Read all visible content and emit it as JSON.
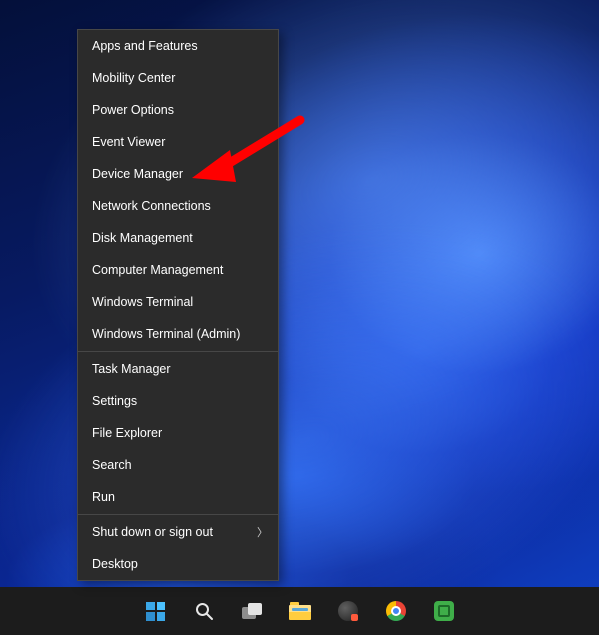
{
  "context_menu": {
    "groups": [
      [
        {
          "label": "Apps and Features",
          "has_submenu": false
        },
        {
          "label": "Mobility Center",
          "has_submenu": false
        },
        {
          "label": "Power Options",
          "has_submenu": false
        },
        {
          "label": "Event Viewer",
          "has_submenu": false
        },
        {
          "label": "Device Manager",
          "has_submenu": false
        },
        {
          "label": "Network Connections",
          "has_submenu": false
        },
        {
          "label": "Disk Management",
          "has_submenu": false
        },
        {
          "label": "Computer Management",
          "has_submenu": false
        },
        {
          "label": "Windows Terminal",
          "has_submenu": false
        },
        {
          "label": "Windows Terminal (Admin)",
          "has_submenu": false
        }
      ],
      [
        {
          "label": "Task Manager",
          "has_submenu": false
        },
        {
          "label": "Settings",
          "has_submenu": false
        },
        {
          "label": "File Explorer",
          "has_submenu": false
        },
        {
          "label": "Search",
          "has_submenu": false
        },
        {
          "label": "Run",
          "has_submenu": false
        }
      ],
      [
        {
          "label": "Shut down or sign out",
          "has_submenu": true
        },
        {
          "label": "Desktop",
          "has_submenu": false
        }
      ]
    ]
  },
  "annotation": {
    "target_label": "Device Manager",
    "arrow_color": "#ff0000"
  },
  "taskbar": {
    "items": [
      {
        "id": "start",
        "name": "Start"
      },
      {
        "id": "search",
        "name": "Search"
      },
      {
        "id": "taskview",
        "name": "Task View"
      },
      {
        "id": "explorer",
        "name": "File Explorer"
      },
      {
        "id": "app-generic",
        "name": "App"
      },
      {
        "id": "chrome",
        "name": "Google Chrome"
      },
      {
        "id": "app-green",
        "name": "App"
      }
    ]
  }
}
